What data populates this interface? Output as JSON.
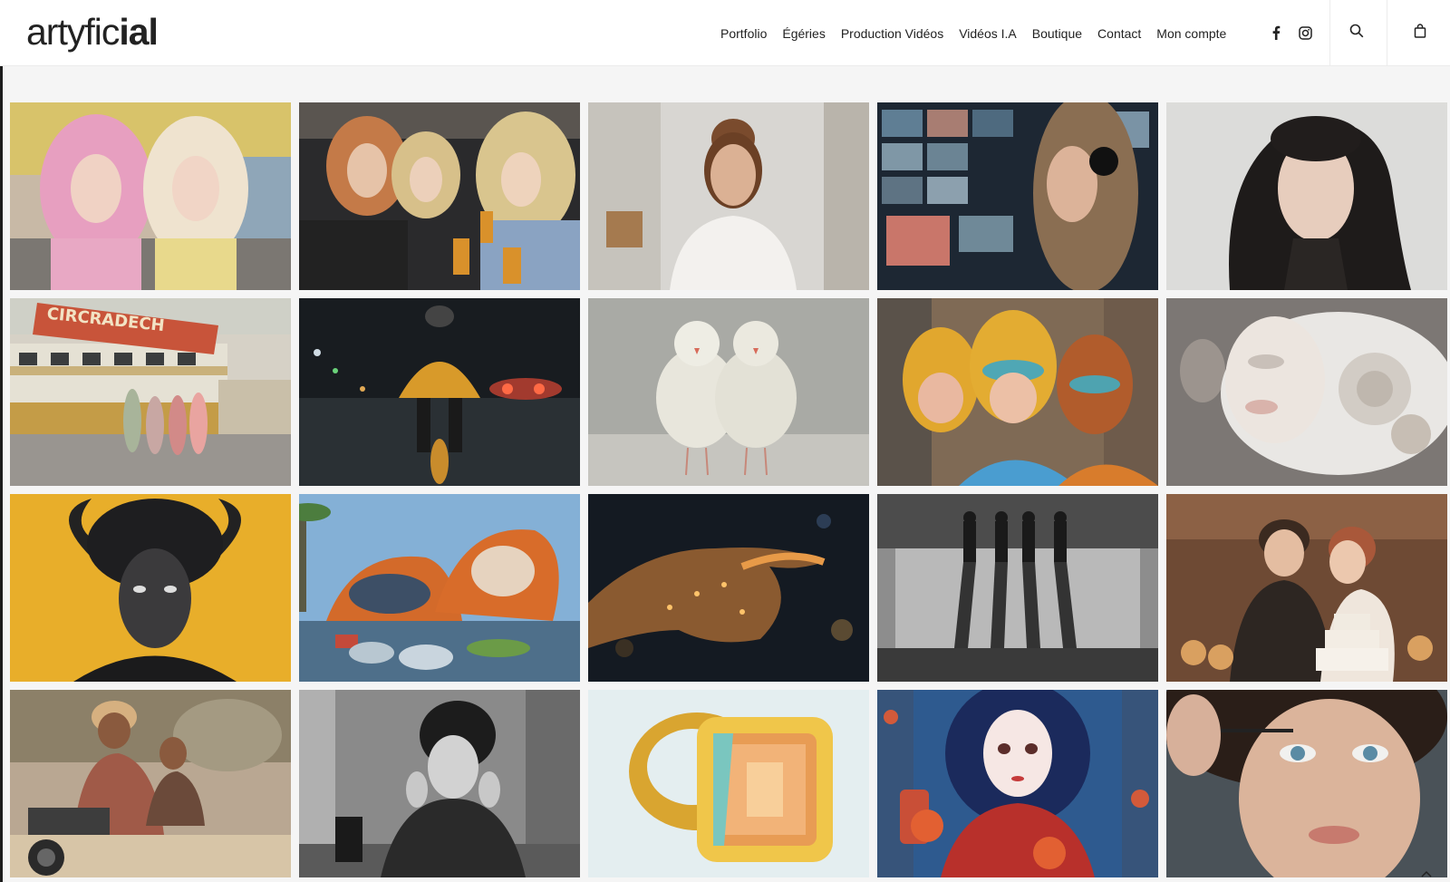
{
  "header": {
    "logo_light": "artyfic",
    "logo_bold": "ial",
    "nav": [
      {
        "label": "Portfolio"
      },
      {
        "label": "Égéries"
      },
      {
        "label": "Production Vidéos"
      },
      {
        "label": "Vidéos I.A"
      },
      {
        "label": "Boutique"
      },
      {
        "label": "Contact"
      },
      {
        "label": "Mon compte"
      }
    ],
    "social_icons": [
      "facebook-icon",
      "instagram-icon"
    ],
    "actions": [
      "search-icon",
      "shopping-bag-icon"
    ]
  },
  "gallery": {
    "sign_text": "CIRCRADECH",
    "items": [
      {
        "subject": "two-women-pink-blonde-wigs"
      },
      {
        "subject": "friends-drinking-beer"
      },
      {
        "subject": "woman-polka-dot-blouse"
      },
      {
        "subject": "woman-headphones-screens"
      },
      {
        "subject": "woman-dark-hair-portrait"
      },
      {
        "subject": "bunnies-in-front-of-building"
      },
      {
        "subject": "cyclist-night-street"
      },
      {
        "subject": "two-fluffy-chicks"
      },
      {
        "subject": "three-masked-heroines"
      },
      {
        "subject": "robot-face-white"
      },
      {
        "subject": "woman-horned-headdress"
      },
      {
        "subject": "orange-futuristic-house"
      },
      {
        "subject": "circuit-robot-hand"
      },
      {
        "subject": "four-silhouettes-shadows"
      },
      {
        "subject": "couple-cutting-wedding-cake"
      },
      {
        "subject": "grandmother-child-motorbike"
      },
      {
        "subject": "woman-black-white-portrait"
      },
      {
        "subject": "gold-ring-gemstone"
      },
      {
        "subject": "anime-girl-red-fruit"
      },
      {
        "subject": "woman-blue-eyes-makeup"
      }
    ]
  },
  "colors": {
    "header_bg": "#ffffff",
    "page_bg": "#f5f5f5",
    "text": "#222222"
  }
}
